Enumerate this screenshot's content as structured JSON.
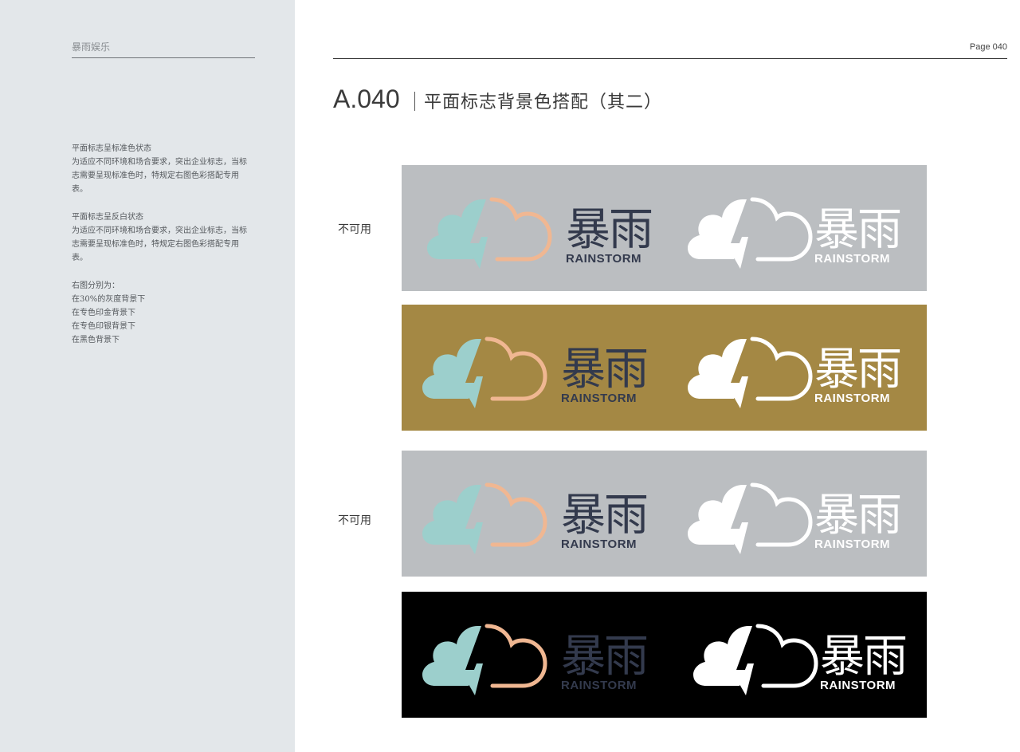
{
  "sidebar": {
    "brand": "暴雨娱乐",
    "blocks": [
      {
        "lines": [
          "平面标志呈标准色状态",
          "为适应不同环境和场合要求，突出企业标志，当标",
          "志需要呈现标准色时，特规定右图色彩搭配专用",
          "表。"
        ]
      },
      {
        "lines": [
          "平面标志呈反白状态",
          "为适应不同环境和场合要求，突出企业标志，当标",
          "志需要呈现标准色时，特规定右图色彩搭配专用",
          "表。"
        ]
      },
      {
        "lines": [
          "右图分别为：",
          "在30%的灰度背景下",
          "在专色印金背景下",
          "在专色印银背景下",
          "在黑色背景下"
        ]
      }
    ]
  },
  "header": {
    "page": "Page 040",
    "code": "A.040",
    "title": "平面标志背景色搭配（其二）"
  },
  "notes": [
    "不可用",
    "不可用"
  ],
  "logo": {
    "chinese": "暴雨",
    "english": "RAINSTORM"
  },
  "colors": {
    "cloud_teal": "#9ccfcc",
    "cloud_orange": "#f0b792",
    "text_navy": "#333a4d",
    "white": "#ffffff"
  },
  "panels": [
    {
      "background": "#bbbec1",
      "name": "30% gray"
    },
    {
      "background": "#a48844",
      "name": "spot gold"
    },
    {
      "background": "#bbbec1",
      "name": "spot silver"
    },
    {
      "background": "#000000",
      "name": "black"
    }
  ]
}
